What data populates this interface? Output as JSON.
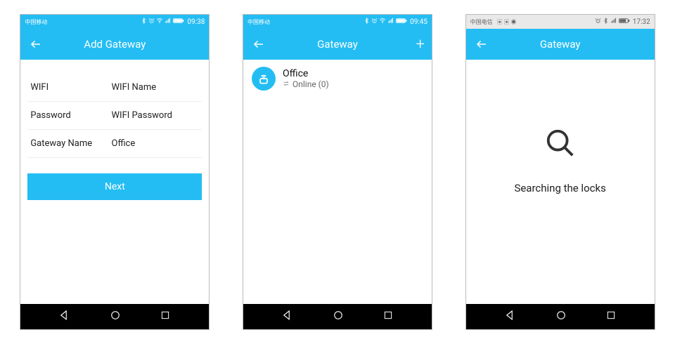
{
  "screens": [
    {
      "status_time": "09:38",
      "title": "Add Gateway",
      "form": {
        "wifi_label": "WIFI",
        "wifi_value": "WIFI Name",
        "password_label": "Password",
        "password_value": "WIFI Password",
        "gateway_label": "Gateway Name",
        "gateway_value": "Office",
        "next_label": "Next"
      },
      "colors": {
        "accent": "#24bdf3"
      }
    },
    {
      "status_time": "09:45",
      "title": "Gateway",
      "items": [
        {
          "name": "Office",
          "status": "Online (0)"
        }
      ],
      "colors": {
        "accent": "#24bdf3"
      }
    },
    {
      "status_time": "17:32",
      "title": "Gateway",
      "searching_text": "Searching the locks",
      "colors": {
        "accent": "#24bdf3"
      }
    }
  ]
}
